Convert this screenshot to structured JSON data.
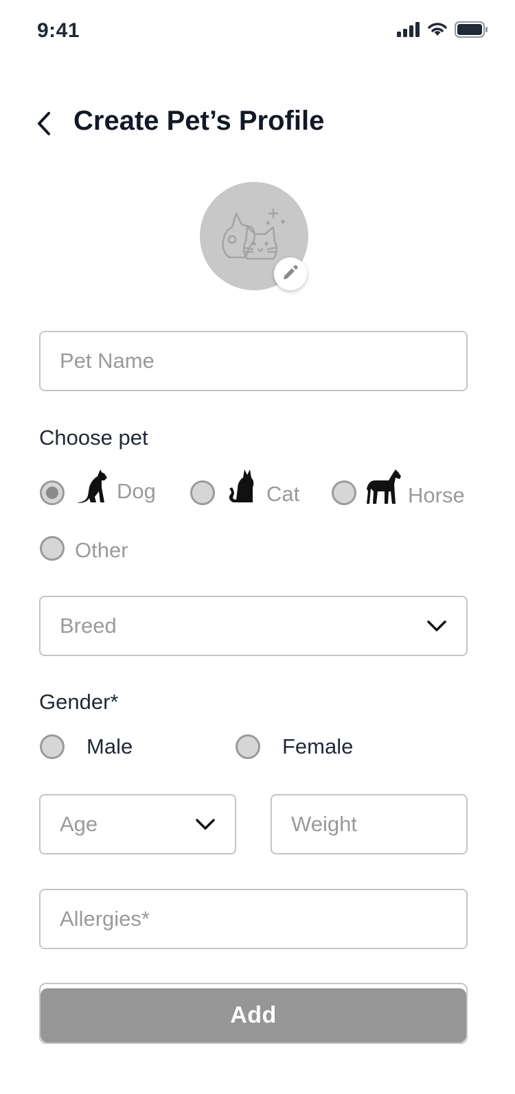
{
  "status_bar": {
    "time": "9:41",
    "icons": [
      "signal-icon",
      "wifi-icon",
      "battery-icon"
    ]
  },
  "header": {
    "back_icon": "chevron-left-icon",
    "title": "Create Pet’s Profile"
  },
  "avatar": {
    "icon": "pet-placeholder-icon",
    "edit_icon": "pencil-icon"
  },
  "form": {
    "pet_name": {
      "placeholder": "Pet Name",
      "value": ""
    },
    "choose_pet": {
      "label": "Choose pet",
      "options": [
        {
          "label": "Dog",
          "icon": "dog-icon",
          "selected": true
        },
        {
          "label": "Cat",
          "icon": "cat-icon",
          "selected": false
        },
        {
          "label": "Horse",
          "icon": "horse-icon",
          "selected": false
        },
        {
          "label": "Other",
          "icon": "",
          "selected": false
        }
      ]
    },
    "breed": {
      "placeholder": "Breed",
      "icon": "chevron-down-icon"
    },
    "gender": {
      "label": "Gender*",
      "options": [
        {
          "label": "Male",
          "selected": false
        },
        {
          "label": "Female",
          "selected": false
        }
      ]
    },
    "age": {
      "placeholder": "Age",
      "icon": "chevron-down-icon"
    },
    "weight": {
      "placeholder": "Weight",
      "value": ""
    },
    "allergies": {
      "placeholder": "Allergies*",
      "value": ""
    },
    "submit_label": "Add"
  },
  "colors": {
    "text_primary": "#111827",
    "placeholder": "#9a9a9a",
    "border": "#c4c4c4",
    "avatar_bg": "#c8c8c8",
    "button_bg": "#969696"
  }
}
